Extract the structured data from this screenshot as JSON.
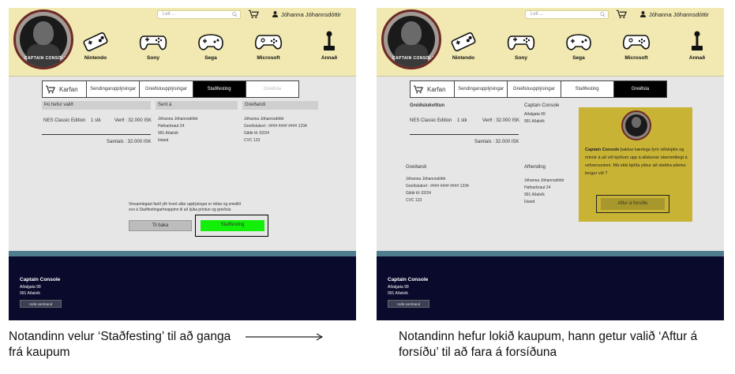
{
  "header": {
    "search_placeholder": "Leit ...",
    "user_name": "Jóhanna Jóhannsdóttir",
    "logo_text": "CAPTAIN CONSOLE",
    "brands": [
      "Nintendo",
      "Sony",
      "Sega",
      "Microsoft",
      "Annað"
    ]
  },
  "steps": {
    "cart": "Karfan",
    "shipping": "Sendingarupplýsingar",
    "payment": "Greiðsluupplýsingar",
    "confirm": "Staðfesting",
    "pay": "Greiðsla"
  },
  "left": {
    "col_chosen": "Þú hefur valið",
    "col_sent": "Sent á",
    "col_payer": "Greiðandi",
    "product": "NES Classic Edition",
    "qty": "1 stk",
    "price": "Verð : 32.000 ISK",
    "total": "Samtals : 32.000 ISK",
    "sent_lines": [
      "Jóhanna Jóhannsdóttir",
      "Hafnarbraut 24",
      "991 Aðalvík",
      "Ísland"
    ],
    "payer_lines": [
      "Jóhanna Jóhannsdóttir",
      "Greiðslukort : #### #### #### 1234",
      "Gildir til: 02/24",
      "CVC 123"
    ],
    "notice_line1": "Vinsamlegast farið yfir hvort allar upplýsingar er réttar og smellið",
    "notice_line2": "svo á Staðfestingarhnappinn  til að ljúka pöntun og greiðslu",
    "back_button": "Til baka",
    "confirm_button": "Staðfesting"
  },
  "right": {
    "receipt_title": "Greiðslukvittun",
    "product": "NES Classic Edition",
    "qty": "1 stk",
    "price": "Verð : 32.000 ISK",
    "total": "Samtals : 32.000 ISK",
    "shop_lines": [
      "Captain Console",
      "Aðalgata 99",
      "991 Aðalvík"
    ],
    "payer_title": "Greiðandi",
    "payer_lines": [
      "Jóhanna Jóhannsdóttir",
      "Greiðslukort : #### #### #### 1234",
      "Gildir til: 02/24",
      "CVC 123"
    ],
    "delivery_title": "Afhending",
    "delivery_lines": [
      "Jóhanna Jóhannsdóttir",
      "Hafnarbraut 24",
      "991 Aðalvík",
      "Ísland"
    ],
    "thanks_brand": "Captain Console",
    "thanks_text": "þakkar kærlega fyrir viðskiptin og minnir á að við bjóðum upp á allskonar skemmtilegt á vefversuninni. Má ekki bjóða ykkur að staldra aðeins lengur við ?",
    "home_button": "Aftur á forsíðu"
  },
  "footer": {
    "title": "Captain Console",
    "address1": "Aðalgata 99",
    "address2": "991 Aðalvík",
    "contact_button": "Hafa samband"
  },
  "captions": {
    "left": "Notandinn velur ‘Staðfesting’ til að ganga frá kaupum",
    "right": "Notandinn hefur lokið kaupum, hann getur valið ‘Aftur á forsíðu’ til að fara á forsíðuna"
  }
}
